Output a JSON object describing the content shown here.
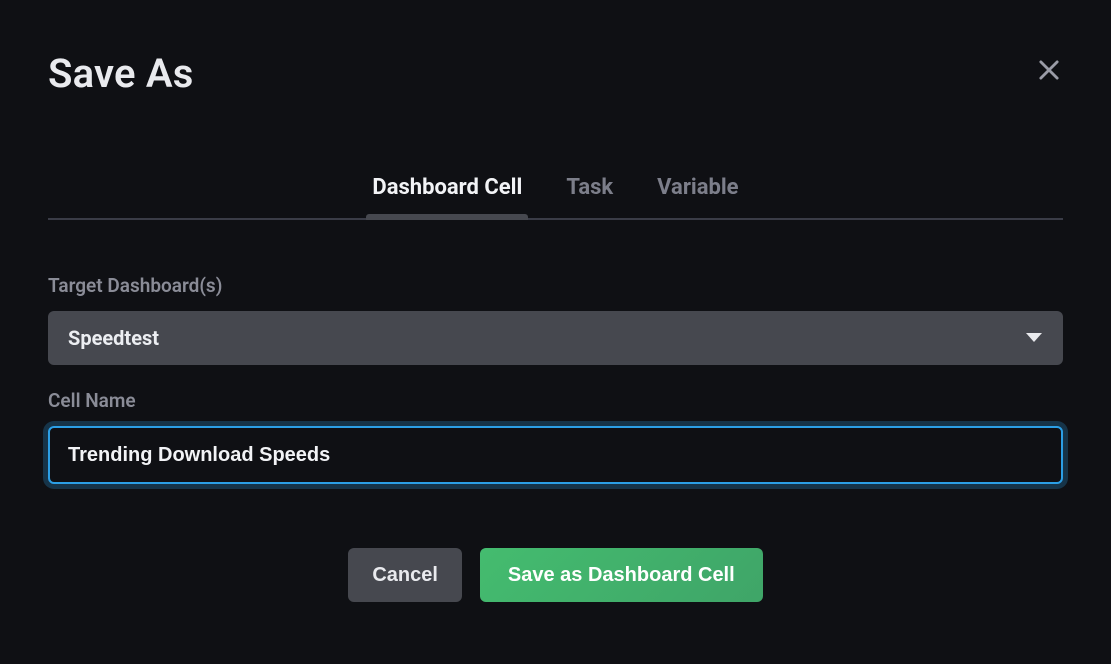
{
  "header": {
    "title": "Save As"
  },
  "tabs": {
    "items": [
      {
        "label": "Dashboard Cell",
        "active": true
      },
      {
        "label": "Task",
        "active": false
      },
      {
        "label": "Variable",
        "active": false
      }
    ]
  },
  "form": {
    "target_label": "Target Dashboard(s)",
    "target_value": "Speedtest",
    "cell_name_label": "Cell Name",
    "cell_name_value": "Trending Download Speeds"
  },
  "actions": {
    "cancel": "Cancel",
    "save": "Save as Dashboard Cell"
  }
}
